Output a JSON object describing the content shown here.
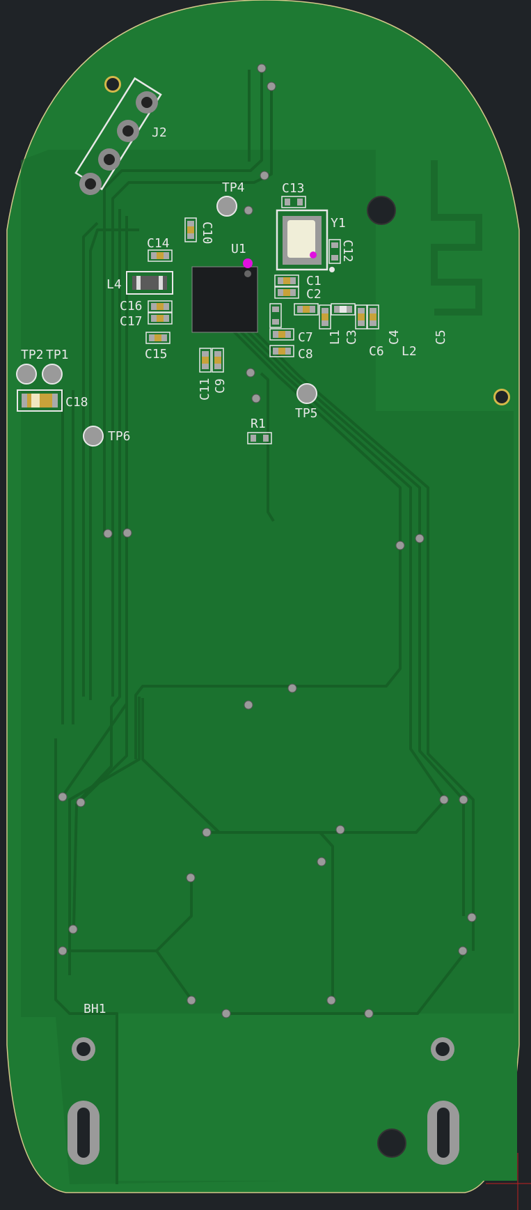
{
  "board": {
    "colors": {
      "background": "#1f2327",
      "soldermask": "#1e7a33",
      "copper_zone": "#1a6b2c",
      "track": "#166026",
      "pad": "#b8b8b8",
      "via": "#9a9a9a",
      "silkscreen": "#e8e8e8",
      "edge": "#d4c88a",
      "marker": "#e010e0"
    },
    "labels": {
      "j2": "J2",
      "tp4": "TP4",
      "c13": "C13",
      "y1": "Y1",
      "c10": "C10",
      "u1": "U1",
      "c12": "C12",
      "c14": "C14",
      "l4": "L4",
      "c1": "C1",
      "c2": "C2",
      "c16": "C16",
      "c17": "C17",
      "c7": "C7",
      "c8": "C8",
      "c15": "C15",
      "l1": "L1",
      "c3": "C3",
      "c6": "C6",
      "c4": "C4",
      "l2": "L2",
      "c5": "C5",
      "tp2": "TP2",
      "tp1": "TP1",
      "c11": "C11",
      "c9": "C9",
      "tp5": "TP5",
      "c18": "C18",
      "r1": "R1",
      "tp6": "TP6",
      "bh1": "BH1"
    }
  }
}
